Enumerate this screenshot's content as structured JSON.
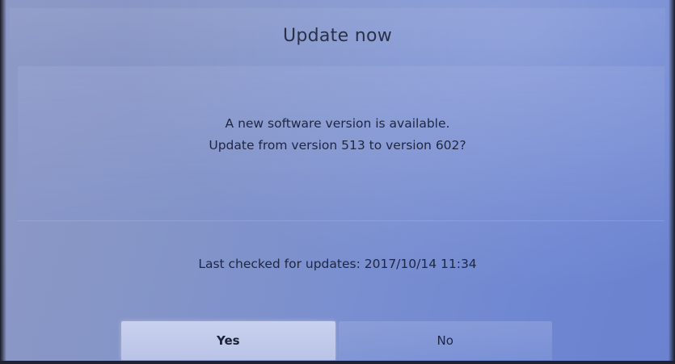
{
  "dialog": {
    "title": "Update now",
    "message_line1": "A new software version is available.",
    "message_line2": "Update from version 513 to version 602?",
    "last_checked": "Last checked for updates: 2017/10/14 11:34"
  },
  "buttons": {
    "yes_label": "Yes",
    "no_label": "No",
    "focused": "Yes"
  },
  "colors": {
    "background": "#7a8fd0",
    "focused_button": "#c9d1ee",
    "text": "#1f2640"
  }
}
